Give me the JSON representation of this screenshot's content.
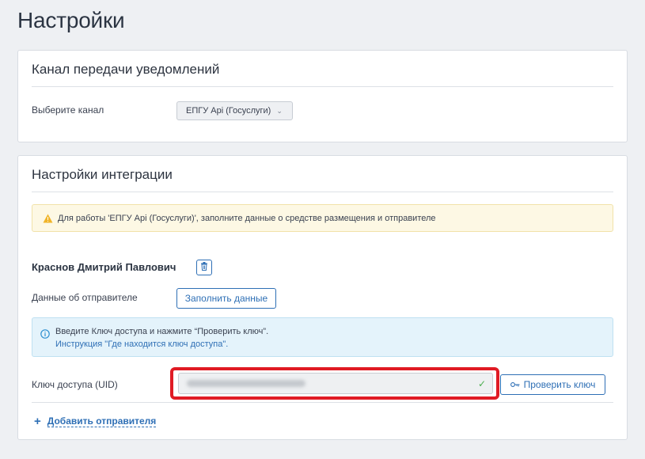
{
  "page": {
    "title": "Настройки"
  },
  "channel_card": {
    "title": "Канал передачи уведомлений",
    "select_label": "Выберите канал",
    "select_value": "ЕПГУ Api (Госуслуги)"
  },
  "integration_card": {
    "title": "Настройки интеграции",
    "warning_text": "Для работы 'ЕПГУ Api (Госуслуги)', заполните данные о средстве размещения и отправителе",
    "sender_name": "Краснов Дмитрий Павлович",
    "sender_data_label": "Данные об отправителе",
    "fill_data_button": "Заполнить данные",
    "info_line1": "Введите Ключ доступа и нажмите “Проверить ключ”.",
    "info_link": "Инструкция \"Где находится ключ доступа\".",
    "uid_label": "Ключ доступа (UID)",
    "check_key_button": "Проверить ключ",
    "add_sender_link": "Добавить отправителя"
  },
  "colors": {
    "accent": "#2e6fb5",
    "highlight": "#e01b24",
    "warning_bg": "#fdf8e4",
    "info_bg": "#e4f3fb",
    "success": "#4caf50"
  },
  "icons": [
    "warning-icon",
    "trash-icon",
    "info-icon",
    "check-icon",
    "key-icon",
    "plus-icon",
    "chevron-down-icon"
  ]
}
